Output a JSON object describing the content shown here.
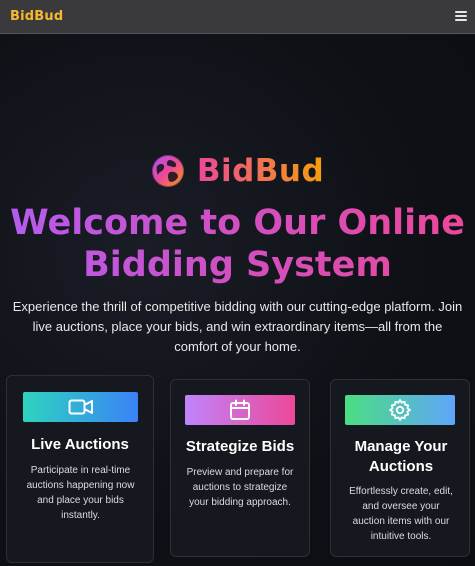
{
  "nav": {
    "brand": "BidBud",
    "menu_icon": "hamburger-menu-icon"
  },
  "hero": {
    "logo_icon": "globe-logo-icon",
    "logo_text": "BidBud",
    "title": "Welcome to Our Online Bidding System",
    "description": "Experience the thrill of competitive bidding with our cutting-edge platform. Join live auctions, place your bids, and win extraordinary items—all from the comfort of your home."
  },
  "features": [
    {
      "icon": "video-camera-icon",
      "title": "Live Auctions",
      "description": "Participate in real-time auctions happening now and place your bids instantly.",
      "gradient": [
        "#2dd4bf",
        "#3b82f6"
      ]
    },
    {
      "icon": "calendar-icon",
      "title": "Strategize Bids",
      "description": "Preview and prepare for auctions to strategize your bidding approach.",
      "gradient": [
        "#c084fc",
        "#ec4899"
      ]
    },
    {
      "icon": "gear-icon",
      "title": "Manage Your Auctions",
      "description": "Effortlessly create, edit, and oversee your auction items with our intuitive tools.",
      "gradient": [
        "#4ade80",
        "#60a5fa"
      ]
    }
  ],
  "colors": {
    "brand_yellow": "#f5b82e",
    "logo_gradient": [
      "#ec4899",
      "#f59e0b"
    ],
    "title_gradient": [
      "#b55cf0",
      "#ec4899"
    ],
    "background": "#0f1117"
  }
}
